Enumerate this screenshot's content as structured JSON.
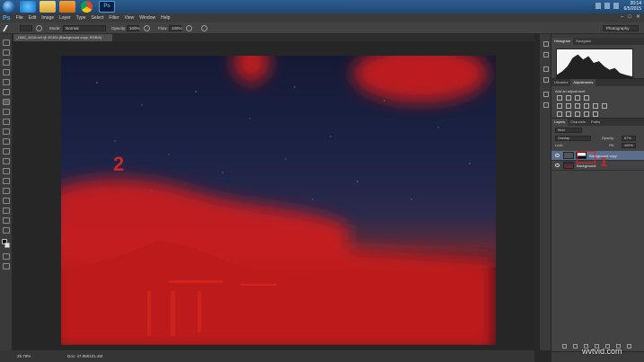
{
  "taskbar": {
    "apps": [
      "ie-icon",
      "folder-icon",
      "media-player-icon",
      "chrome-icon",
      "photoshop-icon"
    ],
    "photoshop_label": "Ps",
    "clock_time": "20:14",
    "clock_date": "6/5/2015"
  },
  "menubar": {
    "logo": "Ps",
    "items": [
      "File",
      "Edit",
      "Image",
      "Layer",
      "Type",
      "Select",
      "Filter",
      "View",
      "Window",
      "Help"
    ]
  },
  "options": {
    "mode_label": "Mode:",
    "mode_value": "Normal",
    "opacity_label": "Opacity:",
    "opacity_value": "100%",
    "flow_label": "Flow:",
    "flow_value": "100%",
    "workspace": "Photography"
  },
  "document": {
    "tab_title": "_DMC_8116.nef @ 25.8% (Background copy, RGB/8)",
    "zoom": "25.79%",
    "doc_size": "Doc: 47.8M/101.4M"
  },
  "annotations": {
    "canvas_number": "2",
    "layers_number": "1"
  },
  "panels": {
    "top_tabs": [
      "Histogram",
      "Navigator"
    ],
    "adj_tabs": [
      "Libraries",
      "Adjustments"
    ],
    "adj_title": "Add an adjustment",
    "layers_tabs": [
      "Layers",
      "Channels",
      "Paths"
    ],
    "kind": "Kind",
    "blend_mode": "Overlay",
    "opacity_label": "Opacity:",
    "opacity_value": "67%",
    "lock_label": "Lock:",
    "fill_label": "Fill:",
    "fill_value": "100%",
    "layers": [
      {
        "name": "Background copy"
      },
      {
        "name": "Background"
      }
    ]
  },
  "watermark": "wvtvid.com",
  "colors": {
    "mask_red": "#d41b1b",
    "ps_blue": "#4da0e8"
  }
}
